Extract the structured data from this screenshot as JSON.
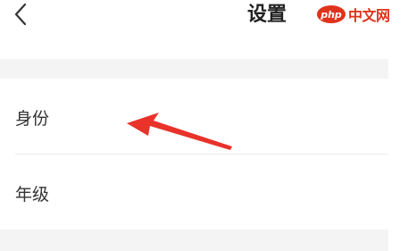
{
  "nav": {
    "title": "设置",
    "back_icon": "chevron-left-icon"
  },
  "watermark": {
    "badge_text": "php",
    "text": "中文网"
  },
  "settings": {
    "rows": [
      {
        "label": "身份"
      },
      {
        "label": "年级"
      }
    ]
  },
  "annotation": {
    "arrow_color": "#e8322a",
    "arrow_icon": "red-arrow-icon"
  },
  "colors": {
    "section_gap": "#f4f4f4",
    "watermark_red": "#e0331c"
  }
}
